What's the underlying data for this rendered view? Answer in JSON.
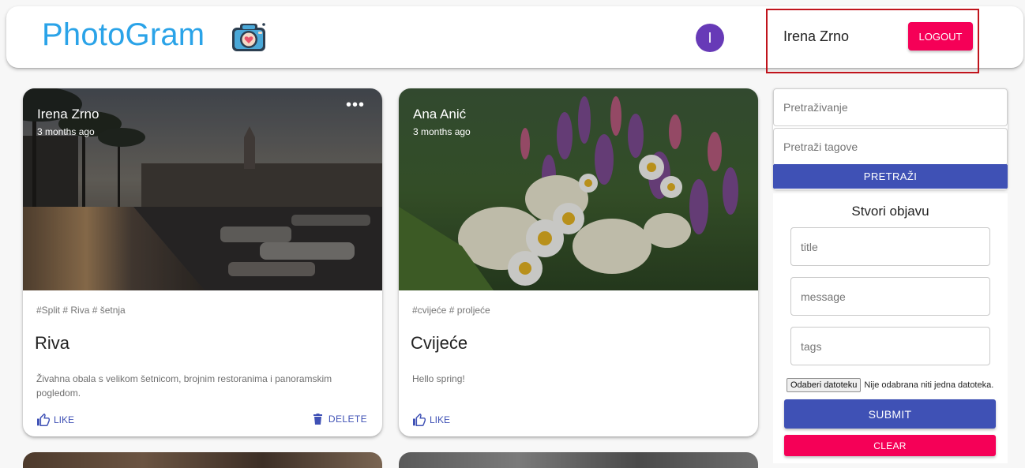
{
  "header": {
    "brand": "PhotoGram",
    "brand_logo_icon": "camera-heart-icon",
    "avatar_initial": "I",
    "avatar_color": "#673ab7",
    "user_name": "Irena Zrno",
    "logout_label": "LOGOUT",
    "brand_color": "#2aa3e8"
  },
  "posts": [
    {
      "author": "Irena Zrno",
      "time": "3 months ago",
      "tags": "#Split # Riva # šetnja",
      "title": "Riva",
      "message": "Živahna obala s velikom šetnicom, brojnim restoranima i panoramskim pogledom.",
      "like_label": "LIKE",
      "delete_label": "DELETE",
      "more_icon": "more-horizontal-icon"
    },
    {
      "author": "Ana Anić",
      "time": "3 months ago",
      "tags": "#cvijeće # proljeće",
      "title": "Cvijeće",
      "message": "Hello spring!",
      "like_label": "LIKE"
    }
  ],
  "search": {
    "search_placeholder": "Pretraživanje",
    "tags_placeholder": "Pretraži tagove",
    "button_label": "PRETRAŽI"
  },
  "form": {
    "title": "Stvori objavu",
    "title_placeholder": "title",
    "message_placeholder": "message",
    "tags_placeholder": "tags",
    "file_button_label": "Odaberi datoteku",
    "file_status": "Nije odabrana niti jedna datoteka.",
    "submit_label": "SUBMIT",
    "clear_label": "CLEAR"
  },
  "colors": {
    "primary": "#3f51b5",
    "secondary": "#f50057"
  }
}
